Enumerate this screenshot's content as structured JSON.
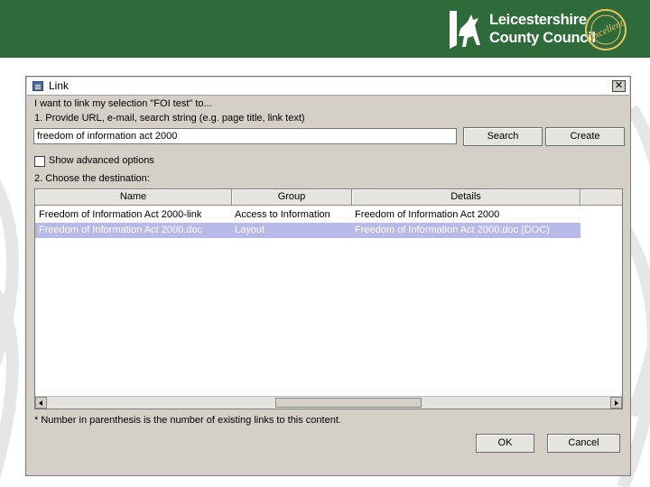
{
  "logo": {
    "line1": "Leicestershire",
    "line2": "County Council",
    "seal_text": "RATED AS Excellent BY COUNCIL"
  },
  "dialog": {
    "title": "Link",
    "close_glyph": "✕",
    "intro": "I want to link my selection \"FOI test\" to...",
    "step1": "1. Provide URL, e-mail, search string (e.g. page title, link text)",
    "url_value": "freedom of information act 2000",
    "search_label": "Search",
    "create_label": "Create",
    "advanced_label": "Show advanced options",
    "advanced_checked": false,
    "step2": "2. Choose the destination:",
    "columns": [
      "Name",
      "Group",
      "Details"
    ],
    "rows": [
      {
        "name": "Freedom of Information Act 2000-link",
        "group": "Access to Information",
        "details": "Freedom of Information Act 2000",
        "selected": false
      },
      {
        "name": "Freedom of Information Act 2000.doc",
        "group": "Layout",
        "details": "Freedom of Information Act 2000.doc (DOC)",
        "selected": true
      }
    ],
    "footnote": "* Number in parenthesis is the number of existing links to this content.",
    "ok_label": "OK",
    "cancel_label": "Cancel"
  },
  "colors": {
    "banner": "#2f6a3a",
    "dialog_bg": "#d4d0c8",
    "selection": "#b7b9e8"
  }
}
